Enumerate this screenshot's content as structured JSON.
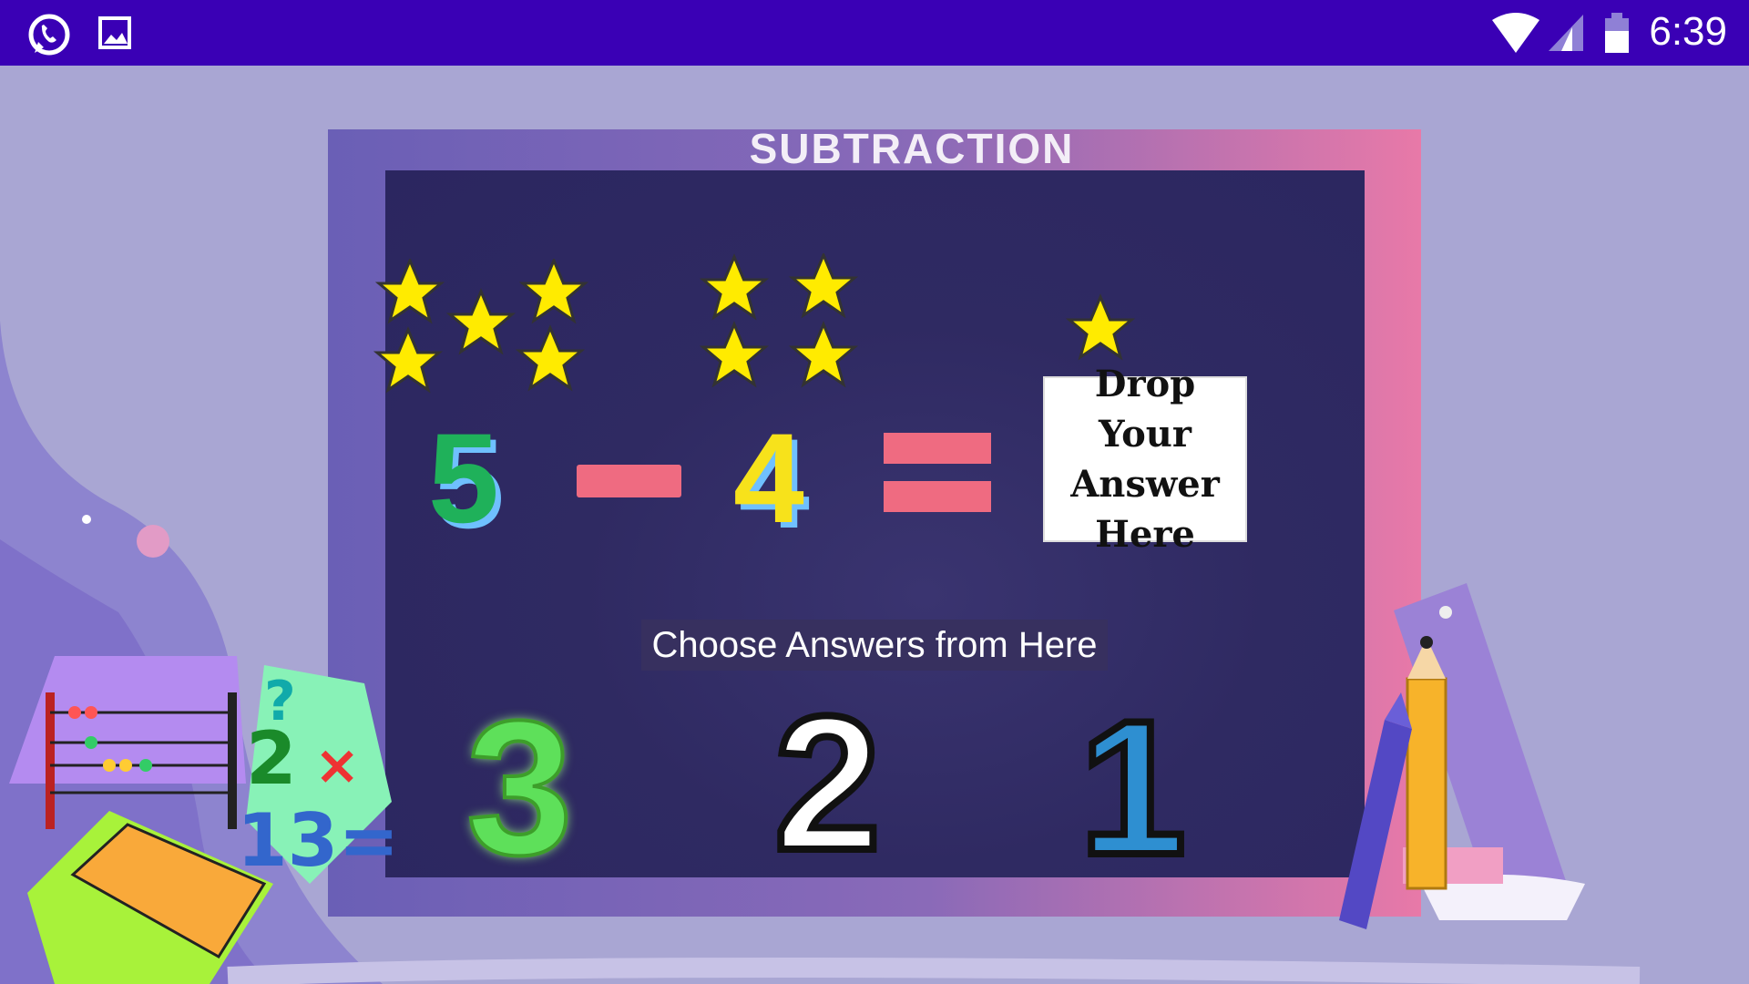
{
  "status_bar": {
    "time": "6:39",
    "icons": [
      "whatsapp-icon",
      "image-icon",
      "wifi-icon",
      "signal-icon",
      "battery-icon"
    ],
    "bg_color": "#3a00b5"
  },
  "game": {
    "title": "SUBTRACTION",
    "equation": {
      "minuend": "5",
      "operator": "−",
      "subtrahend": "4",
      "equals": "="
    },
    "drop_target": {
      "label": "Drop Your Answer Here"
    },
    "stars": {
      "minuend_count": 5,
      "subtrahend_count": 4,
      "answer_count": 1
    },
    "choices_label": "Choose Answers from Here",
    "choices": [
      {
        "value": "3"
      },
      {
        "value": "2"
      },
      {
        "value": "1"
      }
    ]
  },
  "colors": {
    "star": "#ffeb00",
    "operator": "#ef6b81",
    "board": "#2f2a62"
  }
}
